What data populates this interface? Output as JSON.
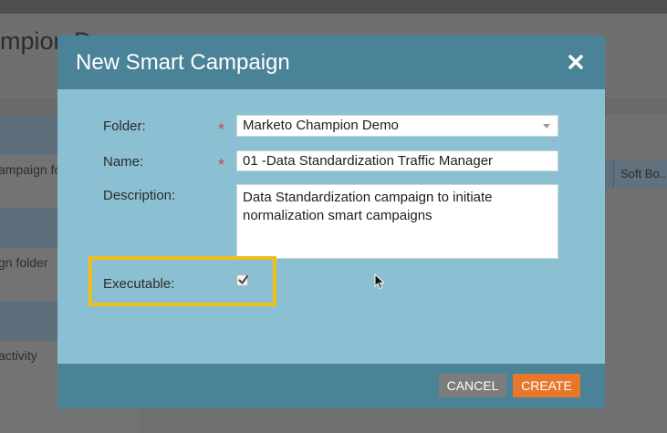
{
  "background": {
    "page_title_fragment": "mpion D",
    "left_items": [
      "ampaign fo",
      "gn folder",
      "activity"
    ],
    "right_cell": "Soft Bo..."
  },
  "dialog": {
    "title": "New Smart Campaign",
    "close_icon": "close-icon",
    "folder": {
      "label": "Folder:",
      "value": "Marketo Champion Demo",
      "required_mark": "*"
    },
    "name": {
      "label": "Name:",
      "value": "01 -Data Standardization Traffic Manager",
      "required_mark": "*"
    },
    "description": {
      "label": "Description:",
      "value": "Data Standardization campaign to initiate normalization smart campaigns"
    },
    "executable": {
      "label": "Executable:",
      "checked": true
    },
    "buttons": {
      "cancel": "CANCEL",
      "create": "CREATE"
    }
  },
  "colors": {
    "dialog_header": "#4a8397",
    "dialog_body": "#8bc0d2",
    "create_button": "#e8762b",
    "cancel_button": "#7c7c7c",
    "highlight_border": "#f2bd1a",
    "required_mark": "#c24d4d"
  }
}
